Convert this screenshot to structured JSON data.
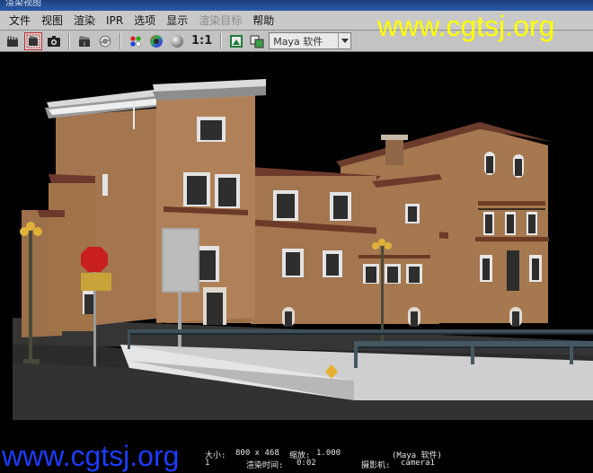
{
  "window": {
    "title": "渲染视图"
  },
  "menu": [
    {
      "label": "文件",
      "enabled": true
    },
    {
      "label": "视图",
      "enabled": true
    },
    {
      "label": "渲染",
      "enabled": true
    },
    {
      "label": "IPR",
      "enabled": true
    },
    {
      "label": "选项",
      "enabled": true
    },
    {
      "label": "显示",
      "enabled": true
    },
    {
      "label": "渲染目标",
      "enabled": false
    },
    {
      "label": "帮助",
      "enabled": true
    }
  ],
  "toolbar": {
    "icons": [
      "clapboard-icon",
      "region-render-icon",
      "snapshot-icon",
      "ipr-render-icon",
      "refresh-icon",
      "rgb-channel-icon",
      "color-wheel-icon",
      "gray-sphere-icon"
    ],
    "ratio_label": "1:1",
    "renderer_dropdown": {
      "value": "Maya 软件"
    }
  },
  "render_info": {
    "size": "800 x 468",
    "zoom": "1.000",
    "renderer": "(Maya 软件)",
    "frame": "1",
    "render_time": "0:02",
    "camera": "camera1",
    "size_label": "大小:",
    "zoom_label": "缩放:",
    "render_time_label": "渲染时间:",
    "camera_label": "摄影机:"
  },
  "watermarks": [
    "www.cgtsj.org",
    "www.cgtsj.org"
  ]
}
